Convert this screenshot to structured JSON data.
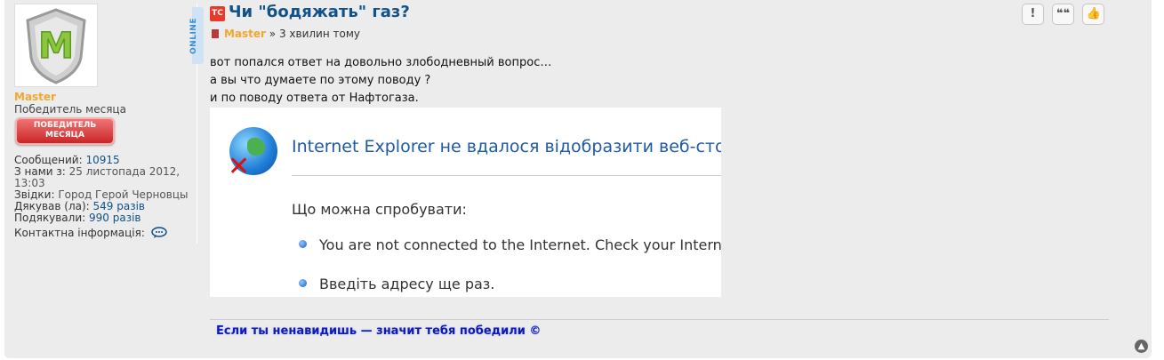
{
  "profile": {
    "avatar_letter": "M",
    "username": "Master",
    "rank": "Победитель месяца",
    "rank_badge_line1": "ПОБЕДИТЕЛЬ",
    "rank_badge_line2": "МЕСЯЦА",
    "online_label": "ONLINE",
    "posts_label": "Сообщений:",
    "posts_value": "10915",
    "joined_label": "З нами з:",
    "joined_value": "25 листопада 2012,",
    "joined_time": "13:03",
    "location_label": "Звідки:",
    "location_value": "Город Герой Черновцы",
    "thanked_label": "Дякував (ла):",
    "thanked_value": "549 разів",
    "was_thanked_label": "Подякували:",
    "was_thanked_value": "990 разів",
    "contact_label": "Контактна інформація:"
  },
  "post": {
    "topic_badge": "ТС",
    "title": "Чи \"бодяжать\" газ?",
    "author": "Master",
    "separator": " » ",
    "time": "3 хвилин тому",
    "lines": [
      "вот попался ответ на довольно злободневный вопрос…",
      "а вы что думаете по этому поводу ?",
      "и по поводу ответа от Нафтогаза."
    ],
    "signature": "Если ты ненавидишь — значит тебя победили ©"
  },
  "embedded_image": {
    "title": "Internet Explorer не вдалося відобразити веб-сторінку",
    "try_heading": "Що можна спробувати:",
    "items": [
      "You are not connected to the Internet. Check your Internet connection.",
      "Введіть адресу ще раз."
    ]
  },
  "buttons": {
    "report": "!",
    "quote": "❝❝",
    "like": "👍",
    "top": "▲"
  }
}
